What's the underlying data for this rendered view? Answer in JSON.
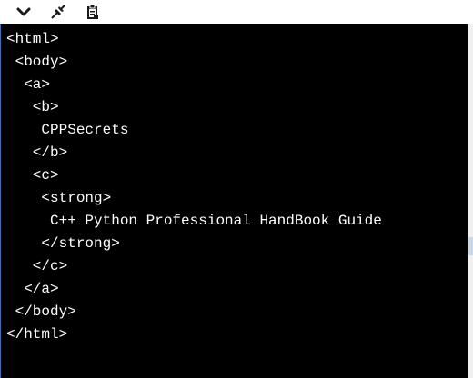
{
  "toolbar": {
    "buttons": [
      {
        "icon": "chevron-down-icon"
      },
      {
        "icon": "pin-icon"
      },
      {
        "icon": "clipboard-icon"
      }
    ]
  },
  "console": {
    "lines": [
      "<html>",
      " <body>",
      "  <a>",
      "   <b>",
      "    CPPSecrets",
      "   </b>",
      "   <c>",
      "    <strong>",
      "     C++ Python Professional HandBook Guide",
      "    </strong>",
      "   </c>",
      "  </a>",
      " </body>",
      "</html>"
    ]
  },
  "colors": {
    "console_bg": "#000000",
    "console_text": "#ffffff",
    "toolbar_bg": "#ffffff",
    "accent_edge": "#2f65b0"
  }
}
